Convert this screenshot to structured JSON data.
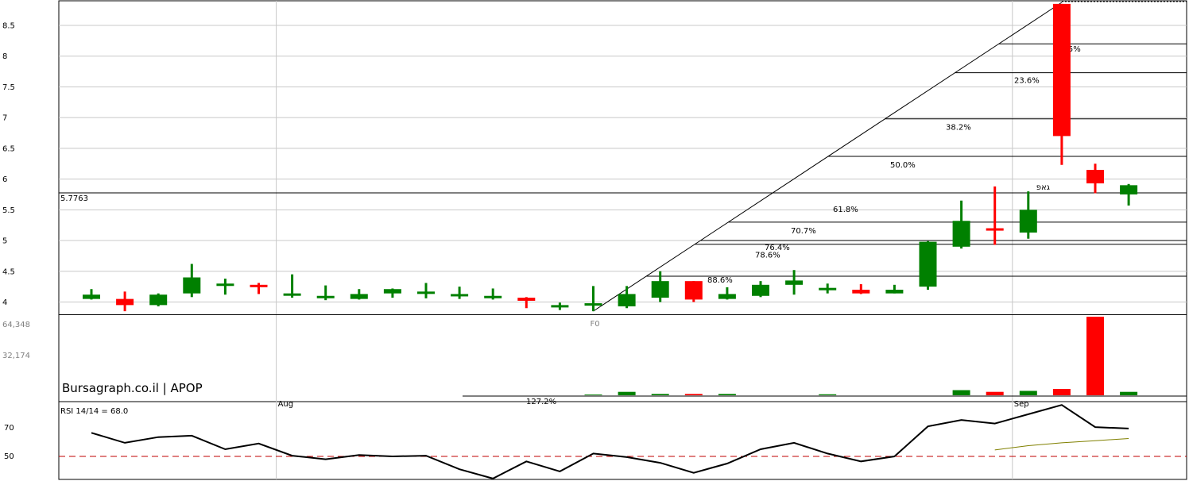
{
  "watermark": "Bursagraph.co.il | APOP",
  "colors": {
    "up": "#008000",
    "down": "#ff0000",
    "grid": "#c8c8c8",
    "rsi_line": "#000000",
    "rsi_ma": "#808000",
    "rsi_ref": "#c00000"
  },
  "chart_data": [
    {
      "type": "candlestick",
      "ylim": [
        3.8,
        8.85
      ],
      "yticks": [
        4,
        4.5,
        5,
        5.5,
        6,
        6.5,
        7,
        7.5,
        8,
        8.5
      ],
      "ytick_labels": [
        "4",
        "4.5",
        "5",
        "5.5",
        "6",
        "6.5",
        "7",
        "7.5",
        "8",
        "8.5"
      ],
      "x_month_labels": [
        {
          "index": 6,
          "label": "Aug"
        },
        {
          "index": 28,
          "label": "Sep"
        }
      ],
      "ohlc": [
        [
          4.05,
          4.21,
          4.04,
          4.12
        ],
        [
          4.05,
          4.17,
          3.85,
          3.95
        ],
        [
          3.95,
          4.14,
          3.93,
          4.12
        ],
        [
          4.14,
          4.62,
          4.08,
          4.4
        ],
        [
          4.3,
          4.38,
          4.12,
          4.3
        ],
        [
          4.28,
          4.31,
          4.13,
          4.25
        ],
        [
          4.14,
          4.45,
          4.07,
          4.14
        ],
        [
          4.1,
          4.27,
          4.03,
          4.1
        ],
        [
          4.05,
          4.21,
          4.04,
          4.13
        ],
        [
          4.14,
          4.22,
          4.07,
          4.21
        ],
        [
          4.17,
          4.31,
          4.06,
          4.17
        ],
        [
          4.13,
          4.25,
          4.05,
          4.13
        ],
        [
          4.1,
          4.22,
          4.04,
          4.1
        ],
        [
          4.07,
          4.08,
          3.9,
          4.02
        ],
        [
          3.95,
          3.99,
          3.87,
          3.95
        ],
        [
          3.98,
          4.26,
          3.85,
          3.98
        ],
        [
          3.93,
          4.26,
          3.9,
          4.13
        ],
        [
          4.07,
          4.5,
          4.0,
          4.34
        ],
        [
          4.34,
          4.34,
          4.0,
          4.04
        ],
        [
          4.05,
          4.24,
          4.04,
          4.13
        ],
        [
          4.1,
          4.34,
          4.08,
          4.28
        ],
        [
          4.28,
          4.52,
          4.12,
          4.35
        ],
        [
          4.2,
          4.3,
          4.14,
          4.23
        ],
        [
          4.2,
          4.29,
          4.13,
          4.14
        ],
        [
          4.14,
          4.28,
          4.14,
          4.2
        ],
        [
          4.25,
          4.99,
          4.2,
          4.98
        ],
        [
          4.9,
          5.65,
          4.87,
          5.32
        ],
        [
          5.2,
          5.88,
          4.93,
          5.18
        ],
        [
          5.13,
          5.8,
          5.03,
          5.5
        ],
        [
          8.85,
          8.85,
          6.23,
          6.7
        ],
        [
          6.15,
          6.25,
          5.77,
          5.93
        ],
        [
          5.75,
          5.92,
          5.57,
          5.9
        ]
      ]
    },
    {
      "type": "bar",
      "series_name": "volume",
      "y_tick_labels": [
        "64,348",
        "32,174"
      ],
      "ylim": [
        0,
        64348
      ],
      "values": [
        0,
        0,
        0,
        0,
        0,
        0,
        300,
        0,
        300,
        0,
        0,
        0,
        0,
        0,
        0,
        600,
        2800,
        1100,
        1100,
        1100,
        0,
        0,
        800,
        0,
        0,
        0,
        4200,
        2800,
        3600,
        5200,
        64348,
        2800,
        600
      ],
      "up": [
        true,
        false,
        true,
        true,
        false,
        false,
        false,
        false,
        true,
        true,
        true,
        false,
        false,
        false,
        false,
        true,
        true,
        true,
        false,
        true,
        true,
        true,
        false,
        false,
        true,
        true,
        true,
        false,
        true,
        false,
        false,
        true
      ],
      "note": "volume bars aligned to candles"
    },
    {
      "type": "line",
      "series_name": "RSI",
      "title": "RSI 14/14 = 68.0",
      "yticks": [
        50,
        70
      ],
      "ylim": [
        32,
        90
      ],
      "reference": 50,
      "values": [
        66.5,
        59.5,
        63.5,
        64.5,
        55.0,
        59.0,
        50.5,
        48.0,
        51.0,
        50.0,
        50.5,
        41.0,
        34.5,
        46.5,
        39.5,
        52.0,
        49.5,
        45.5,
        38.5,
        45.0,
        55.0,
        59.5,
        52.0,
        46.5,
        50.0,
        71.0,
        75.5,
        73.0,
        79.5,
        86.0,
        70.5,
        69.5
      ],
      "ma_start_index": 28,
      "ma_values": [
        54.5,
        57.5,
        59.5,
        61.0,
        62.5
      ]
    }
  ],
  "fib": {
    "label_F0": "F0",
    "low_label": "5.7763",
    "levels": [
      {
        "pct": "14.5%",
        "price": 8.2
      },
      {
        "pct": "23.6%",
        "price": 7.73
      },
      {
        "pct": "38.2%",
        "price": 6.98
      },
      {
        "pct": "50.0%",
        "price": 6.37
      },
      {
        "pct": "61.8%",
        "price": 5.76
      },
      {
        "pct": "70.7%",
        "price": 5.3
      },
      {
        "pct": "76.4%",
        "price": 5.0
      },
      {
        "pct": "78.6%",
        "price": 4.94
      },
      {
        "pct": "88.6%",
        "price": 4.42
      },
      {
        "pct": "127.2%",
        "price": 3.8
      }
    ],
    "hebrew_label": "גאפ"
  }
}
